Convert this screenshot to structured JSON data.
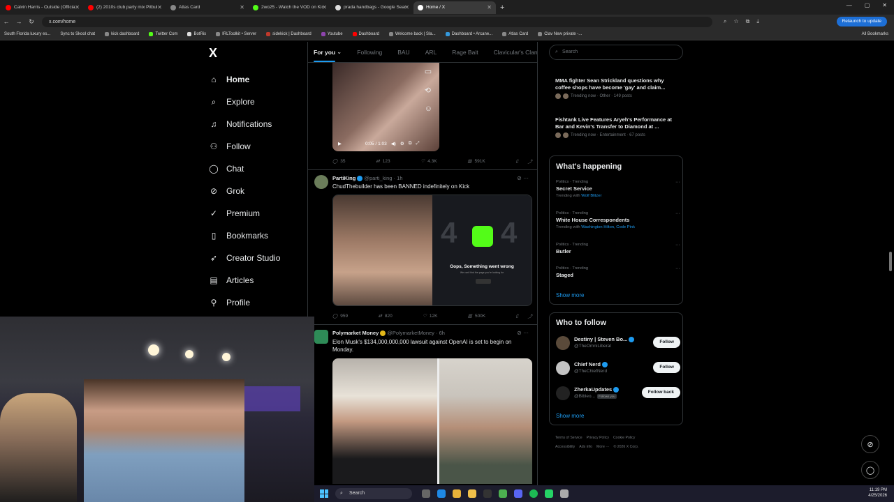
{
  "browser": {
    "tabs": [
      {
        "label": "Calvin Harris - Outside (Officia",
        "color": "#ff0000"
      },
      {
        "label": "(2) 2010s club party mix Pitbul",
        "color": "#ff0000"
      },
      {
        "label": "Atlas Card",
        "color": "#888888"
      },
      {
        "label": "2wo25 - Watch the VOD on Kic",
        "color": "#53fc18"
      },
      {
        "label": "prada handbags - Google Sear",
        "color": "#dddddd"
      },
      {
        "label": "Home / X",
        "color": "#ffffff"
      }
    ],
    "new_tab": "+",
    "url": "x.com/home",
    "relaunch": "Relaunch to update",
    "bookmarks": [
      "South Florida luxury es...",
      "Sync to Skool chat",
      "kick dashboard",
      "Twitter Com",
      "BotRix",
      "IRLToolkit • Server",
      "sidekick | Dashboard",
      "Youtube",
      "Dashboard",
      "Welcome back | Sla...",
      "Dashboard • Arcane...",
      "Atlas Card",
      "Clav New private -..."
    ],
    "all_bookmarks": "All Bookmarks"
  },
  "nav": {
    "logo": "X",
    "items": [
      {
        "label": "Home",
        "icon": "home-icon",
        "glyph": "⌂"
      },
      {
        "label": "Explore",
        "icon": "search-icon",
        "glyph": "⌕"
      },
      {
        "label": "Notifications",
        "icon": "bell-icon",
        "glyph": "♫"
      },
      {
        "label": "Follow",
        "icon": "person-add-icon",
        "glyph": "⚇"
      },
      {
        "label": "Chat",
        "icon": "chat-icon",
        "glyph": "◯"
      },
      {
        "label": "Grok",
        "icon": "grok-icon",
        "glyph": "⊘"
      },
      {
        "label": "Premium",
        "icon": "premium-icon",
        "glyph": "✓"
      },
      {
        "label": "Bookmarks",
        "icon": "bookmark-icon",
        "glyph": "▯"
      },
      {
        "label": "Creator Studio",
        "icon": "rocket-icon",
        "glyph": "➶"
      },
      {
        "label": "Articles",
        "icon": "article-icon",
        "glyph": "▤"
      },
      {
        "label": "Profile",
        "icon": "profile-icon",
        "glyph": "⚲"
      }
    ]
  },
  "feed": {
    "tabs": [
      "For you",
      "Following",
      "BAU",
      "ARL",
      "Rage Bait",
      "Clavicular's Clan",
      "E"
    ],
    "video": {
      "time": "0:05 / 1:03"
    },
    "post1_stats": {
      "replies": "35",
      "reposts": "123",
      "likes": "4.3K",
      "views": "591K"
    },
    "post2": {
      "name": "PartiKing",
      "handle": "@parti_king · 1h",
      "text": "ChudThebuilder has been BANNED indefinitely on Kick",
      "err_title": "Oops, Something went wrong",
      "err_sub": "We can't find the page you're looking for",
      "stats": {
        "replies": "959",
        "reposts": "820",
        "likes": "12K",
        "views": "500K"
      }
    },
    "post3": {
      "name": "Polymarket Money",
      "handle": "@PolymarketMoney · 6h",
      "text": "Elon Musk's $134,000,000,000 lawsuit against OpenAI is set to begin on Monday."
    }
  },
  "right": {
    "search_placeholder": "Search",
    "top_trends": [
      {
        "title": "MMA fighter Sean Strickland questions why coffee shops have become 'gay' and claim...",
        "meta": "Trending now · Other · 149 posts"
      },
      {
        "title": "Fishtank Live Features Aryeh's Performance at Bar and Kevin's Transfer to Diamond at ...",
        "meta": "Trending now · Entertainment · 67 posts"
      }
    ],
    "happening_title": "What's happening",
    "trends": [
      {
        "cat": "Politics · Trending",
        "name": "Secret Service",
        "with_label": "Trending with",
        "with": "Wolf Blitzer"
      },
      {
        "cat": "Politics · Trending",
        "name": "White House Correspondents",
        "with_label": "Trending with",
        "with": "Washington Hilton, Code Pink"
      },
      {
        "cat": "Politics · Trending",
        "name": "Butler",
        "with_label": "",
        "with": ""
      },
      {
        "cat": "Politics · Trending",
        "name": "Staged",
        "with_label": "",
        "with": ""
      }
    ],
    "show_more": "Show more",
    "wtf_title": "Who to follow",
    "who_to_follow": [
      {
        "name": "Destiny | Steven Bo...",
        "handle": "@TheOmniLiberal",
        "button": "Follow",
        "follows_you": ""
      },
      {
        "name": "Chief Nerd",
        "handle": "@TheChiefNerd",
        "button": "Follow",
        "follows_you": ""
      },
      {
        "name": "ZherkaUpdates",
        "handle": "@Bibleo...",
        "button": "Follow back",
        "follows_you": "Follows you"
      }
    ],
    "footer": [
      "Terms of Service",
      "Privacy Policy",
      "Cookie Policy",
      "Accessibility",
      "Ads info",
      "More ···",
      "© 2026 X Corp."
    ]
  },
  "taskbar": {
    "search": "Search",
    "time": "11:19 PM",
    "date": "4/25/2026"
  },
  "colors": {
    "accent": "#1d9bf0",
    "kick": "#53fc18",
    "bg": "#000000"
  }
}
